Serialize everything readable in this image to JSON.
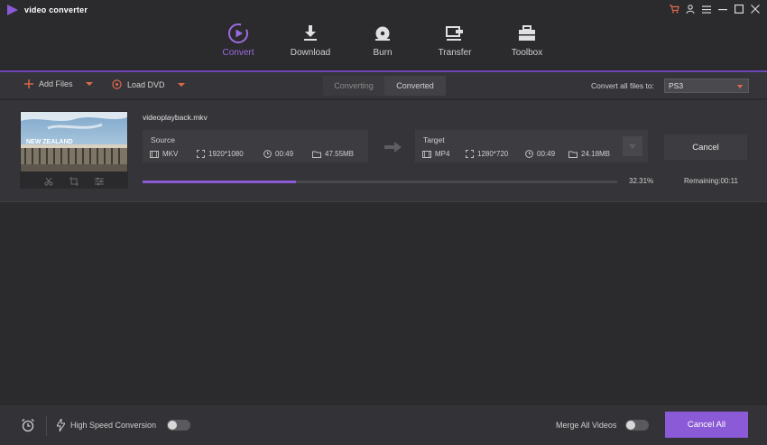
{
  "app": {
    "title": "video converter"
  },
  "nav": {
    "items": [
      {
        "label": "Convert",
        "active": true
      },
      {
        "label": "Download"
      },
      {
        "label": "Burn"
      },
      {
        "label": "Transfer"
      },
      {
        "label": "Toolbox"
      }
    ]
  },
  "toolbar": {
    "add_files": "Add Files",
    "load_dvd": "Load DVD",
    "tabs": [
      "Converting",
      "Converted"
    ],
    "convert_all_label": "Convert all files to:",
    "convert_all_value": "PS3"
  },
  "file": {
    "name": "videoplayback.mkv",
    "thumbnail_text": "NEW ZEALAND",
    "source": {
      "label": "Source",
      "format": "MKV",
      "resolution": "1920*1080",
      "duration": "00:49",
      "size": "47.55MB"
    },
    "target": {
      "label": "Target",
      "format": "MP4",
      "resolution": "1280*720",
      "duration": "00:49",
      "size": "24.18MB"
    },
    "cancel_label": "Cancel",
    "progress_text": "32.31%",
    "progress_fraction": 0.3231,
    "remaining": "Remaining:00:11"
  },
  "bottom": {
    "high_speed_label": "High Speed Conversion",
    "merge_label": "Merge All Videos",
    "cancel_all_label": "Cancel All"
  },
  "colors": {
    "accent": "#8b5ad6",
    "caret": "#e06a4a",
    "background": "#2b2a2d"
  }
}
